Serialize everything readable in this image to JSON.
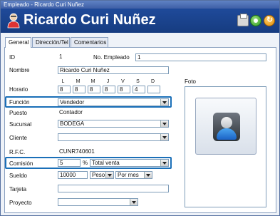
{
  "window": {
    "title": "Empleado - Ricardo Curi Nuñez"
  },
  "header": {
    "title": "Ricardo Curi Nuñez"
  },
  "tabs": [
    {
      "label": "General"
    },
    {
      "label": "Dirección/Tel"
    },
    {
      "label": "Comentarios"
    }
  ],
  "form": {
    "id": {
      "label": "ID",
      "value": "1"
    },
    "no_empleado": {
      "label": "No. Empleado",
      "value": "1"
    },
    "nombre": {
      "label": "Nombre",
      "value": "Ricardo Curi Nuñez"
    },
    "horario": {
      "label": "Horario",
      "days": [
        "L",
        "M",
        "M",
        "J",
        "V",
        "S",
        "D"
      ],
      "values": [
        "8",
        "8",
        "8",
        "8",
        "8",
        "4",
        ""
      ]
    },
    "funcion": {
      "label": "Función",
      "value": "Vendedor"
    },
    "puesto": {
      "label": "Puesto",
      "value": "Contador"
    },
    "sucursal": {
      "label": "Sucursal",
      "value": "BODEGA"
    },
    "cliente": {
      "label": "Cliente",
      "value": ""
    },
    "rfc": {
      "label": "R.F.C.",
      "value": "CUNR740601"
    },
    "comision": {
      "label": "Comisión",
      "value": "5",
      "unit": "%",
      "basis": "Total venta"
    },
    "sueldo": {
      "label": "Sueldo",
      "value": "10000",
      "currency": "Peso",
      "period": "Por mes"
    },
    "tarjeta": {
      "label": "Tarjeta",
      "value": ""
    },
    "proyecto": {
      "label": "Proyecto",
      "value": ""
    }
  },
  "photo": {
    "label": "Foto"
  },
  "colors": {
    "header": "#1f4a9a",
    "highlight": "#1a6fb8"
  }
}
